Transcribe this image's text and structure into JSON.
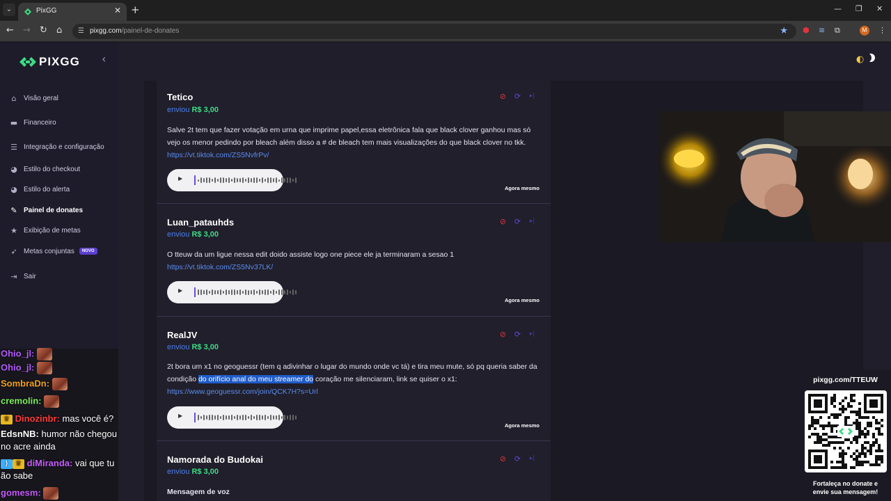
{
  "browser": {
    "tab_title": "PixGG",
    "url_host": "pixgg.com",
    "url_path": "/painel-de-donates",
    "profile_initial": "M"
  },
  "app": {
    "logo_text": "PIXGG",
    "menu": [
      {
        "label": "Visão geral",
        "icon": "home-icon"
      },
      {
        "label": "Financeiro",
        "icon": "wallet-icon"
      },
      {
        "label": "Integração e configuração",
        "icon": "settings-icon"
      },
      {
        "label": "Estilo do checkout",
        "icon": "palette-icon"
      },
      {
        "label": "Estilo do alerta",
        "icon": "palette-icon"
      },
      {
        "label": "Painel de donates",
        "icon": "pen-icon",
        "active": true
      },
      {
        "label": "Exibição de metas",
        "icon": "star-icon"
      },
      {
        "label": "Metas conjuntas",
        "icon": "target-icon",
        "badge": "NOVO"
      },
      {
        "label": "Sair",
        "icon": "logout-icon"
      }
    ]
  },
  "donations": [
    {
      "name": "Tetico",
      "sent": "enviou",
      "amount": "R$ 3,00",
      "message": "Salve 2t tem que fazer votação em urna que imprime papel,essa eletrônica fala que black clover ganhou mas só vejo os menor pedindo por bleach além disso a # de bleach tem mais visualizações do que black clover no tkk. ",
      "link": "https://vt.tiktok.com/ZS5NvfrPv/",
      "time": "Agora mesmo"
    },
    {
      "name": "Luan_patauhds",
      "sent": "enviou",
      "amount": "R$ 3,00",
      "message": "O tteuw da um ligue nessa edit doido assiste logo one piece ele ja terminaram a sesao 1",
      "link": "https://vt.tiktok.com/ZS5Nv37LK/",
      "time": "Agora mesmo"
    },
    {
      "name": "RealJV",
      "sent": "enviou",
      "amount": "R$ 3,00",
      "message_a": "2t bora um x1 no geoguessr (tem q adivinhar o lugar do mundo onde vc tá) e tira meu mute, só pq queria saber da condição ",
      "message_hl": "do orifício anal do meu streamer do",
      "message_b": " coração me silenciaram, link se quiser o x1:",
      "link": "https://www.geoguessr.com/join/QCK7H?s=Url",
      "time": "Agora mesmo"
    },
    {
      "name": "Namorada do Budokai",
      "sent": "enviou",
      "amount": "R$ 3,00",
      "message": "Mensagem de voz"
    }
  ],
  "chat": [
    {
      "user": "Ohio_jl:",
      "color": "#b45bff",
      "text": ""
    },
    {
      "user": "Ohio_jl:",
      "color": "#b45bff",
      "text": ""
    },
    {
      "user": "SombraDn:",
      "color": "#f4a21b",
      "text": ""
    },
    {
      "user": "cremolin:",
      "color": "#7cf05b",
      "text": ""
    },
    {
      "user": "Dinozinbr:",
      "color": "#ff3b3b",
      "text": "mas você é?"
    },
    {
      "user": "EdsnNB:",
      "color": "#ffffff",
      "text": "humor não chegou"
    },
    {
      "user": "",
      "color": "#ffffff",
      "text": "no acre ainda"
    },
    {
      "user": "diMiranda:",
      "color": "#c75bff",
      "text": "vai que tu"
    },
    {
      "user": "",
      "color": "#ffffff",
      "text": "ão sabe"
    },
    {
      "user": "gomesm:",
      "color": "#c75bff",
      "text": ""
    }
  ],
  "qr": {
    "url": "pixgg.com/TTEUW",
    "cta_line1": "Fortaleça no donate e",
    "cta_line2": "envie sua mensagem!"
  },
  "colors": {
    "accent_green": "#3ddc84",
    "link_blue": "#5b8cf0",
    "danger": "#e0353c",
    "purple": "#5b49d6"
  }
}
